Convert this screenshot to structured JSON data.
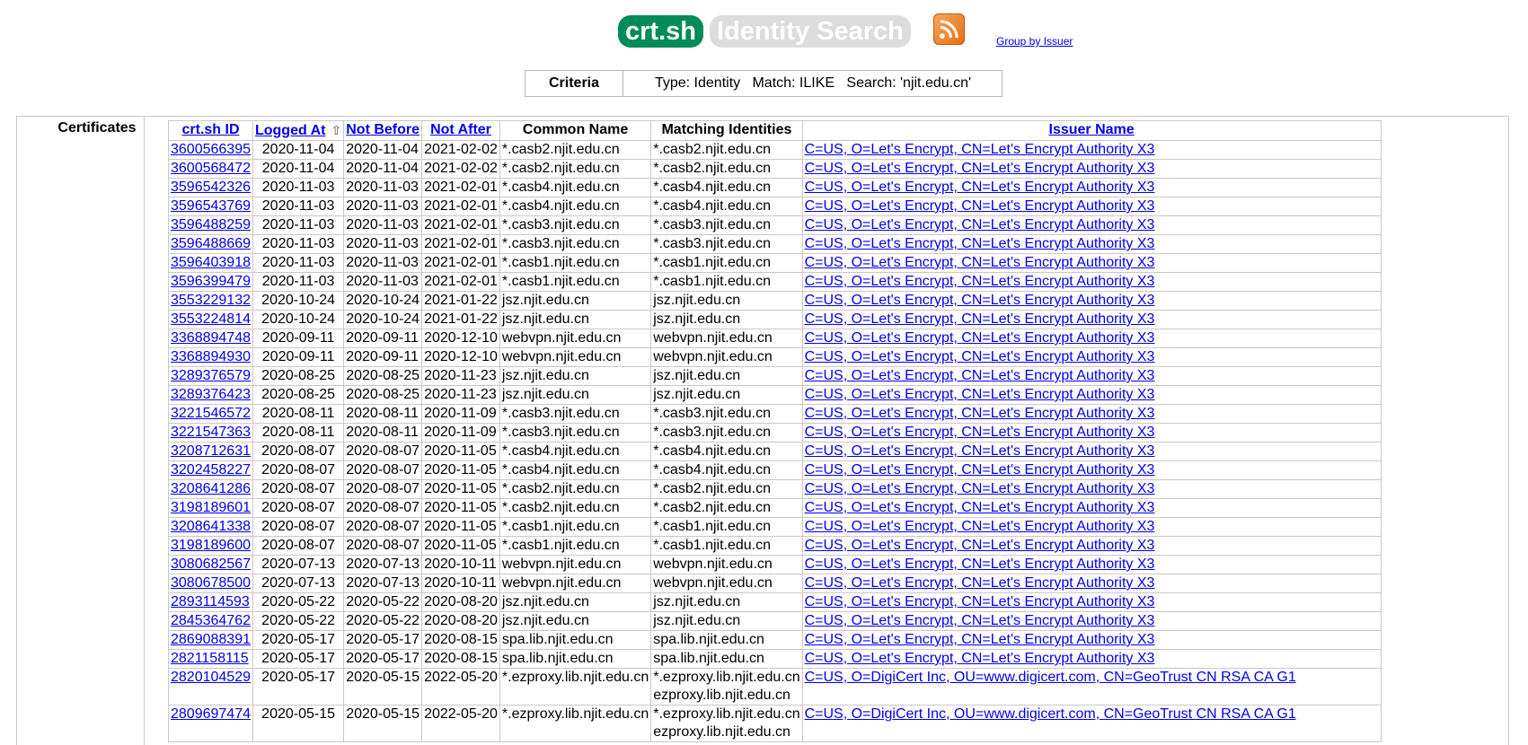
{
  "header": {
    "logo_main": "crt.sh",
    "logo_sub": "Identity Search",
    "group_link": "Group by Issuer"
  },
  "criteria": {
    "label": "Criteria",
    "text": "Type: Identity   Match: ILIKE   Search: 'njit.edu.cn'"
  },
  "section_label": "Certificates",
  "columns": {
    "id": "crt.sh ID",
    "logged_at": "Logged At",
    "sort_arrow": "⇧",
    "not_before": "Not Before",
    "not_after": "Not After",
    "common_name": "Common Name",
    "matching": "Matching Identities",
    "issuer": "Issuer Name"
  },
  "rows": [
    {
      "id": "3600566395",
      "logged": "2020-11-04",
      "nb": "2020-11-04",
      "na": "2021-02-02",
      "cn": "*.casb2.njit.edu.cn",
      "mi": [
        "*.casb2.njit.edu.cn"
      ],
      "issuer": "C=US, O=Let's Encrypt, CN=Let's Encrypt Authority X3"
    },
    {
      "id": "3600568472",
      "logged": "2020-11-04",
      "nb": "2020-11-04",
      "na": "2021-02-02",
      "cn": "*.casb2.njit.edu.cn",
      "mi": [
        "*.casb2.njit.edu.cn"
      ],
      "issuer": "C=US, O=Let's Encrypt, CN=Let's Encrypt Authority X3"
    },
    {
      "id": "3596542326",
      "logged": "2020-11-03",
      "nb": "2020-11-03",
      "na": "2021-02-01",
      "cn": "*.casb4.njit.edu.cn",
      "mi": [
        "*.casb4.njit.edu.cn"
      ],
      "issuer": "C=US, O=Let's Encrypt, CN=Let's Encrypt Authority X3"
    },
    {
      "id": "3596543769",
      "logged": "2020-11-03",
      "nb": "2020-11-03",
      "na": "2021-02-01",
      "cn": "*.casb4.njit.edu.cn",
      "mi": [
        "*.casb4.njit.edu.cn"
      ],
      "issuer": "C=US, O=Let's Encrypt, CN=Let's Encrypt Authority X3"
    },
    {
      "id": "3596488259",
      "logged": "2020-11-03",
      "nb": "2020-11-03",
      "na": "2021-02-01",
      "cn": "*.casb3.njit.edu.cn",
      "mi": [
        "*.casb3.njit.edu.cn"
      ],
      "issuer": "C=US, O=Let's Encrypt, CN=Let's Encrypt Authority X3"
    },
    {
      "id": "3596488669",
      "logged": "2020-11-03",
      "nb": "2020-11-03",
      "na": "2021-02-01",
      "cn": "*.casb3.njit.edu.cn",
      "mi": [
        "*.casb3.njit.edu.cn"
      ],
      "issuer": "C=US, O=Let's Encrypt, CN=Let's Encrypt Authority X3"
    },
    {
      "id": "3596403918",
      "logged": "2020-11-03",
      "nb": "2020-11-03",
      "na": "2021-02-01",
      "cn": "*.casb1.njit.edu.cn",
      "mi": [
        "*.casb1.njit.edu.cn"
      ],
      "issuer": "C=US, O=Let's Encrypt, CN=Let's Encrypt Authority X3"
    },
    {
      "id": "3596399479",
      "logged": "2020-11-03",
      "nb": "2020-11-03",
      "na": "2021-02-01",
      "cn": "*.casb1.njit.edu.cn",
      "mi": [
        "*.casb1.njit.edu.cn"
      ],
      "issuer": "C=US, O=Let's Encrypt, CN=Let's Encrypt Authority X3"
    },
    {
      "id": "3553229132",
      "logged": "2020-10-24",
      "nb": "2020-10-24",
      "na": "2021-01-22",
      "cn": "jsz.njit.edu.cn",
      "mi": [
        "jsz.njit.edu.cn"
      ],
      "issuer": "C=US, O=Let's Encrypt, CN=Let's Encrypt Authority X3"
    },
    {
      "id": "3553224814",
      "logged": "2020-10-24",
      "nb": "2020-10-24",
      "na": "2021-01-22",
      "cn": "jsz.njit.edu.cn",
      "mi": [
        "jsz.njit.edu.cn"
      ],
      "issuer": "C=US, O=Let's Encrypt, CN=Let's Encrypt Authority X3"
    },
    {
      "id": "3368894748",
      "logged": "2020-09-11",
      "nb": "2020-09-11",
      "na": "2020-12-10",
      "cn": "webvpn.njit.edu.cn",
      "mi": [
        "webvpn.njit.edu.cn"
      ],
      "issuer": "C=US, O=Let's Encrypt, CN=Let's Encrypt Authority X3"
    },
    {
      "id": "3368894930",
      "logged": "2020-09-11",
      "nb": "2020-09-11",
      "na": "2020-12-10",
      "cn": "webvpn.njit.edu.cn",
      "mi": [
        "webvpn.njit.edu.cn"
      ],
      "issuer": "C=US, O=Let's Encrypt, CN=Let's Encrypt Authority X3"
    },
    {
      "id": "3289376579",
      "logged": "2020-08-25",
      "nb": "2020-08-25",
      "na": "2020-11-23",
      "cn": "jsz.njit.edu.cn",
      "mi": [
        "jsz.njit.edu.cn"
      ],
      "issuer": "C=US, O=Let's Encrypt, CN=Let's Encrypt Authority X3"
    },
    {
      "id": "3289376423",
      "logged": "2020-08-25",
      "nb": "2020-08-25",
      "na": "2020-11-23",
      "cn": "jsz.njit.edu.cn",
      "mi": [
        "jsz.njit.edu.cn"
      ],
      "issuer": "C=US, O=Let's Encrypt, CN=Let's Encrypt Authority X3"
    },
    {
      "id": "3221546572",
      "logged": "2020-08-11",
      "nb": "2020-08-11",
      "na": "2020-11-09",
      "cn": "*.casb3.njit.edu.cn",
      "mi": [
        "*.casb3.njit.edu.cn"
      ],
      "issuer": "C=US, O=Let's Encrypt, CN=Let's Encrypt Authority X3"
    },
    {
      "id": "3221547363",
      "logged": "2020-08-11",
      "nb": "2020-08-11",
      "na": "2020-11-09",
      "cn": "*.casb3.njit.edu.cn",
      "mi": [
        "*.casb3.njit.edu.cn"
      ],
      "issuer": "C=US, O=Let's Encrypt, CN=Let's Encrypt Authority X3"
    },
    {
      "id": "3208712631",
      "logged": "2020-08-07",
      "nb": "2020-08-07",
      "na": "2020-11-05",
      "cn": "*.casb4.njit.edu.cn",
      "mi": [
        "*.casb4.njit.edu.cn"
      ],
      "issuer": "C=US, O=Let's Encrypt, CN=Let's Encrypt Authority X3"
    },
    {
      "id": "3202458227",
      "logged": "2020-08-07",
      "nb": "2020-08-07",
      "na": "2020-11-05",
      "cn": "*.casb4.njit.edu.cn",
      "mi": [
        "*.casb4.njit.edu.cn"
      ],
      "issuer": "C=US, O=Let's Encrypt, CN=Let's Encrypt Authority X3"
    },
    {
      "id": "3208641286",
      "logged": "2020-08-07",
      "nb": "2020-08-07",
      "na": "2020-11-05",
      "cn": "*.casb2.njit.edu.cn",
      "mi": [
        "*.casb2.njit.edu.cn"
      ],
      "issuer": "C=US, O=Let's Encrypt, CN=Let's Encrypt Authority X3"
    },
    {
      "id": "3198189601",
      "logged": "2020-08-07",
      "nb": "2020-08-07",
      "na": "2020-11-05",
      "cn": "*.casb2.njit.edu.cn",
      "mi": [
        "*.casb2.njit.edu.cn"
      ],
      "issuer": "C=US, O=Let's Encrypt, CN=Let's Encrypt Authority X3"
    },
    {
      "id": "3208641338",
      "logged": "2020-08-07",
      "nb": "2020-08-07",
      "na": "2020-11-05",
      "cn": "*.casb1.njit.edu.cn",
      "mi": [
        "*.casb1.njit.edu.cn"
      ],
      "issuer": "C=US, O=Let's Encrypt, CN=Let's Encrypt Authority X3"
    },
    {
      "id": "3198189600",
      "logged": "2020-08-07",
      "nb": "2020-08-07",
      "na": "2020-11-05",
      "cn": "*.casb1.njit.edu.cn",
      "mi": [
        "*.casb1.njit.edu.cn"
      ],
      "issuer": "C=US, O=Let's Encrypt, CN=Let's Encrypt Authority X3"
    },
    {
      "id": "3080682567",
      "logged": "2020-07-13",
      "nb": "2020-07-13",
      "na": "2020-10-11",
      "cn": "webvpn.njit.edu.cn",
      "mi": [
        "webvpn.njit.edu.cn"
      ],
      "issuer": "C=US, O=Let's Encrypt, CN=Let's Encrypt Authority X3"
    },
    {
      "id": "3080678500",
      "logged": "2020-07-13",
      "nb": "2020-07-13",
      "na": "2020-10-11",
      "cn": "webvpn.njit.edu.cn",
      "mi": [
        "webvpn.njit.edu.cn"
      ],
      "issuer": "C=US, O=Let's Encrypt, CN=Let's Encrypt Authority X3"
    },
    {
      "id": "2893114593",
      "logged": "2020-05-22",
      "nb": "2020-05-22",
      "na": "2020-08-20",
      "cn": "jsz.njit.edu.cn",
      "mi": [
        "jsz.njit.edu.cn"
      ],
      "issuer": "C=US, O=Let's Encrypt, CN=Let's Encrypt Authority X3"
    },
    {
      "id": "2845364762",
      "logged": "2020-05-22",
      "nb": "2020-05-22",
      "na": "2020-08-20",
      "cn": "jsz.njit.edu.cn",
      "mi": [
        "jsz.njit.edu.cn"
      ],
      "issuer": "C=US, O=Let's Encrypt, CN=Let's Encrypt Authority X3"
    },
    {
      "id": "2869088391",
      "logged": "2020-05-17",
      "nb": "2020-05-17",
      "na": "2020-08-15",
      "cn": "spa.lib.njit.edu.cn",
      "mi": [
        "spa.lib.njit.edu.cn"
      ],
      "issuer": "C=US, O=Let's Encrypt, CN=Let's Encrypt Authority X3"
    },
    {
      "id": "2821158115",
      "logged": "2020-05-17",
      "nb": "2020-05-17",
      "na": "2020-08-15",
      "cn": "spa.lib.njit.edu.cn",
      "mi": [
        "spa.lib.njit.edu.cn"
      ],
      "issuer": "C=US, O=Let's Encrypt, CN=Let's Encrypt Authority X3"
    },
    {
      "id": "2820104529",
      "logged": "2020-05-17",
      "nb": "2020-05-15",
      "na": "2022-05-20",
      "cn": "*.ezproxy.lib.njit.edu.cn",
      "mi": [
        "*.ezproxy.lib.njit.edu.cn",
        "ezproxy.lib.njit.edu.cn"
      ],
      "issuer": "C=US, O=DigiCert Inc, OU=www.digicert.com, CN=GeoTrust CN RSA CA G1"
    },
    {
      "id": "2809697474",
      "logged": "2020-05-15",
      "nb": "2020-05-15",
      "na": "2022-05-20",
      "cn": "*.ezproxy.lib.njit.edu.cn",
      "mi": [
        "*.ezproxy.lib.njit.edu.cn",
        "ezproxy.lib.njit.edu.cn"
      ],
      "issuer": "C=US, O=DigiCert Inc, OU=www.digicert.com, CN=GeoTrust CN RSA CA G1"
    }
  ]
}
